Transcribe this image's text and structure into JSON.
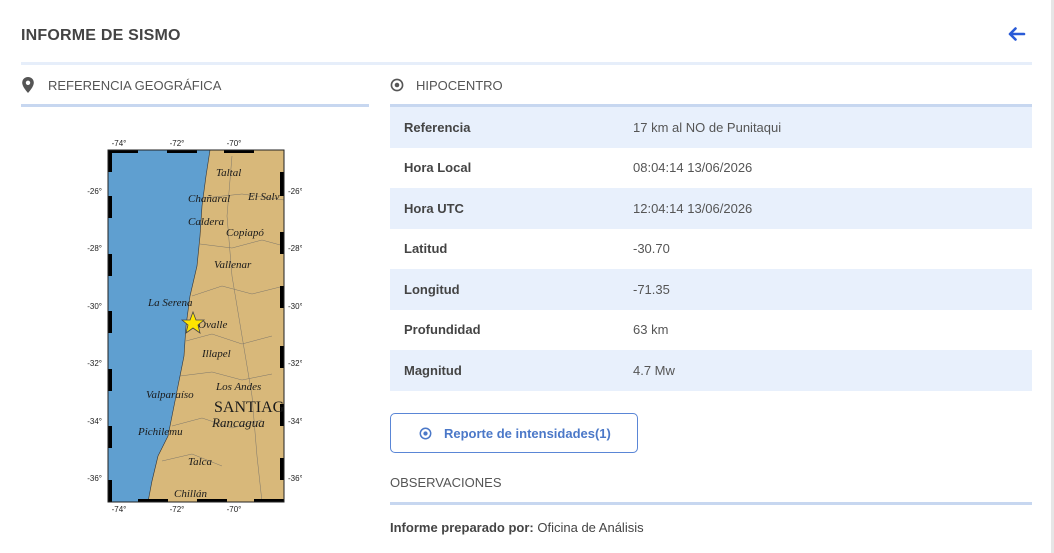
{
  "header": {
    "title": "INFORME DE SISMO"
  },
  "geo": {
    "label": "REFERENCIA GEOGRÁFICA"
  },
  "map": {
    "top_ticks": [
      "-74°",
      "-72°",
      "-70°"
    ],
    "bottom_ticks": [
      "-74°",
      "-72°",
      "-70°"
    ],
    "lat_ticks": [
      "-26°",
      "-28°",
      "-30°",
      "-32°",
      "-34°",
      "-36°"
    ],
    "places": [
      "Taltal",
      "El Salv",
      "Chañaral",
      "Caldera",
      "Copiapó",
      "Vallenar",
      "La Serena",
      "Ovalle",
      "Illapel",
      "Los Andes",
      "Valparaíso",
      "SANTIAG",
      "Rancagua",
      "Pichilemu",
      "Talca",
      "Chillán"
    ],
    "colors": {
      "sea": "#5f9fd0",
      "land": "#d8b87a",
      "marker": "#ffe500"
    },
    "marker_icon": "star-icon"
  },
  "hypocenter": {
    "label": "HIPOCENTRO",
    "rows": [
      {
        "key": "Referencia",
        "value": "17 km al NO de Punitaqui"
      },
      {
        "key": "Hora Local",
        "value": "08:04:14 13/06/2026"
      },
      {
        "key": "Hora UTC",
        "value": "12:04:14 13/06/2026"
      },
      {
        "key": "Latitud",
        "value": "-30.70"
      },
      {
        "key": "Longitud",
        "value": "-71.35"
      },
      {
        "key": "Profundidad",
        "value": "63 km"
      },
      {
        "key": "Magnitud",
        "value": "4.7 Mw"
      }
    ]
  },
  "report_button": {
    "label": "Reporte de intensidades(1)"
  },
  "observations": {
    "label": "OBSERVACIONES",
    "prepared_label": "Informe preparado por:",
    "prepared_value": "Oficina de Análisis"
  },
  "theme": {
    "accent": "#4b78c8",
    "row_alt": "#e8f0fc",
    "divider": "#c7d7f0"
  }
}
